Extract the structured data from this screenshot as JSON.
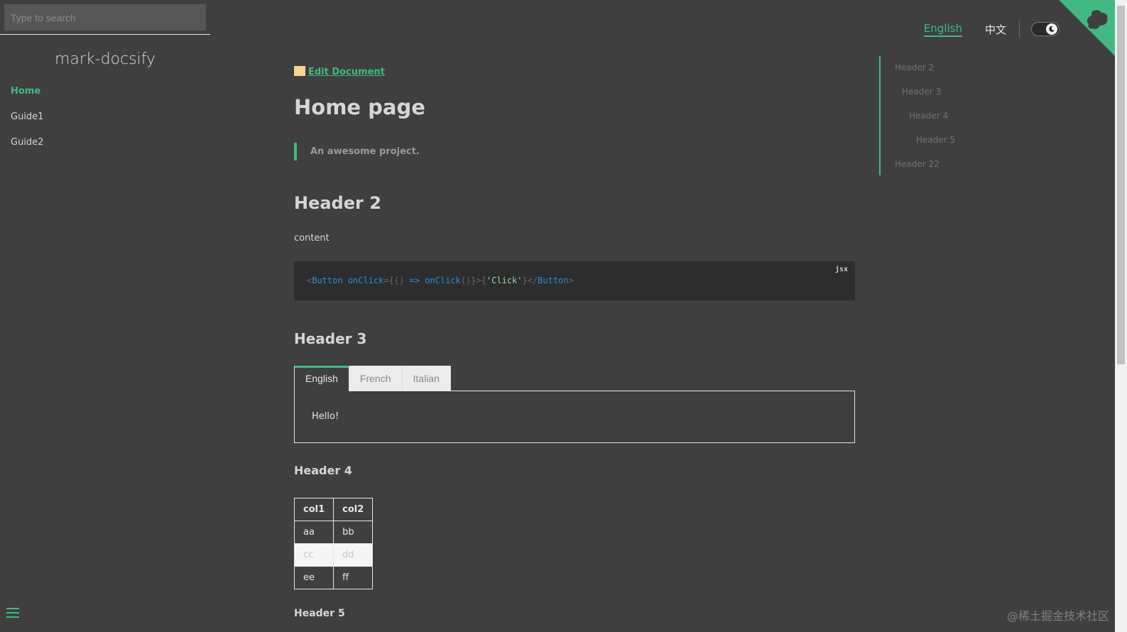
{
  "search": {
    "placeholder": "Type to search"
  },
  "app": {
    "name": "mark-docsify"
  },
  "sidebar": {
    "items": [
      {
        "label": "Home",
        "active": true
      },
      {
        "label": "Guide1",
        "active": false
      },
      {
        "label": "Guide2",
        "active": false
      }
    ]
  },
  "topnav": {
    "english": "English",
    "chinese": "中文",
    "theme_icon": "moon-icon"
  },
  "main": {
    "edit_link": "Edit Document",
    "title": "Home page",
    "quote": "An awesome project.",
    "h2": "Header 2",
    "content_text": "content",
    "code": {
      "lang": "jsx",
      "tokens": [
        {
          "t": "<",
          "c": "punc"
        },
        {
          "t": "Button",
          "c": "tag"
        },
        {
          "t": " onClick",
          "c": "tag"
        },
        {
          "t": "={() ",
          "c": "punc"
        },
        {
          "t": "=>",
          "c": "tag"
        },
        {
          "t": " onClick",
          "c": "tag"
        },
        {
          "t": "()}>{",
          "c": "punc"
        },
        {
          "t": "'Click'",
          "c": "str"
        },
        {
          "t": "}</",
          "c": "punc"
        },
        {
          "t": "Button",
          "c": "tag"
        },
        {
          "t": ">",
          "c": "punc"
        }
      ]
    },
    "h3": "Header 3",
    "tabs": [
      {
        "label": "English",
        "active": true
      },
      {
        "label": "French",
        "active": false
      },
      {
        "label": "Italian",
        "active": false
      }
    ],
    "tab_panel_text": "Hello!",
    "h4": "Header 4",
    "table": {
      "headers": [
        "col1",
        "col2"
      ],
      "rows": [
        [
          "aa",
          "bb"
        ],
        [
          "cc",
          "dd"
        ],
        [
          "ee",
          "ff"
        ]
      ]
    },
    "h5": "Header 5"
  },
  "toc": {
    "items": [
      {
        "label": "Header 2",
        "level": 2
      },
      {
        "label": "Header 3",
        "level": 3
      },
      {
        "label": "Header 4",
        "level": 4
      },
      {
        "label": "Header 5",
        "level": 5
      },
      {
        "label": "Header 22",
        "level": 2
      }
    ]
  },
  "watermark": "@稀土掘金技术社区",
  "colors": {
    "accent": "#42b983",
    "background": "#3f3f3f"
  }
}
